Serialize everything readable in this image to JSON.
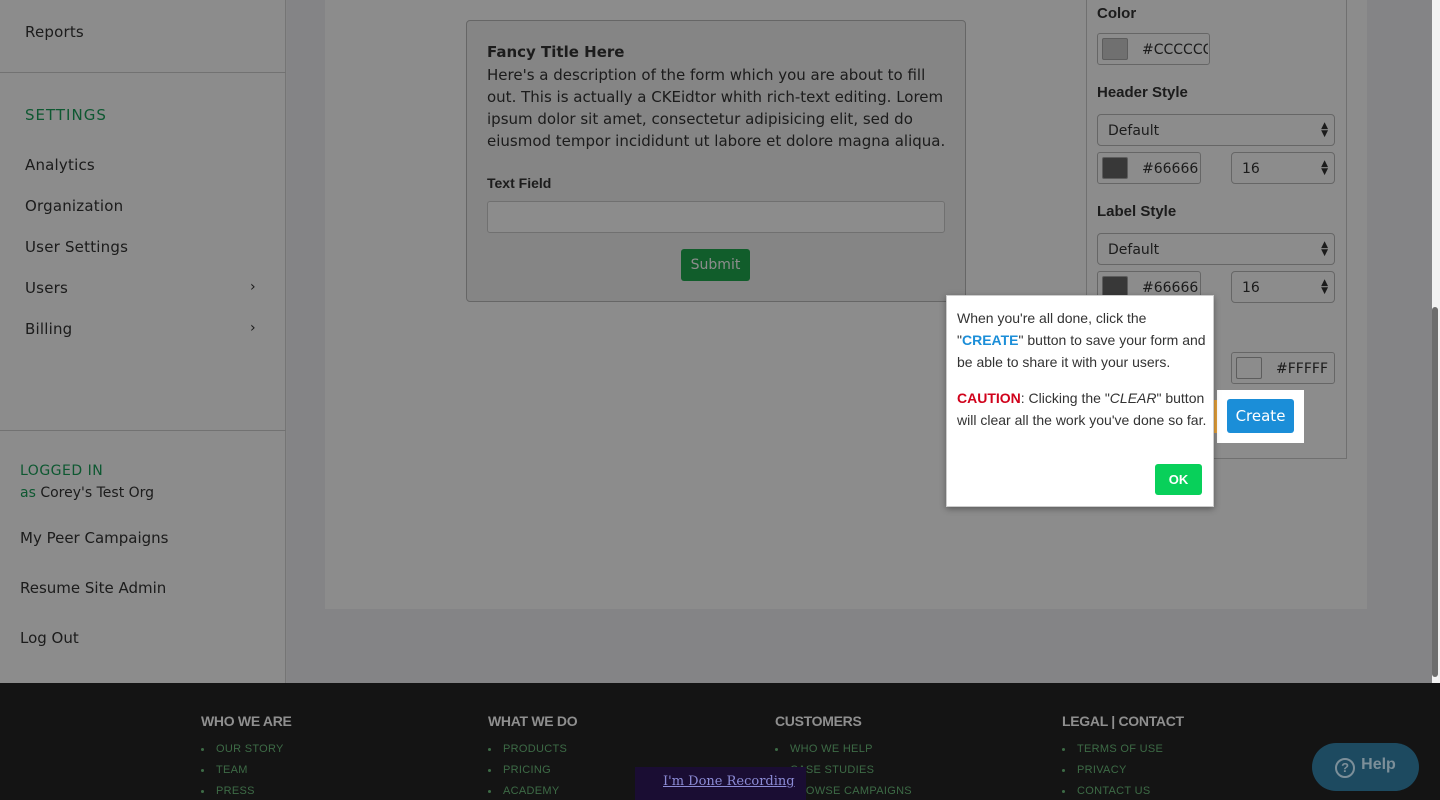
{
  "sidebar": {
    "reports": "Reports",
    "settings_heading": "SETTINGS",
    "items": [
      {
        "label": "Analytics"
      },
      {
        "label": "Organization"
      },
      {
        "label": "User Settings"
      },
      {
        "label": "Users",
        "chevron": "›"
      },
      {
        "label": "Billing",
        "chevron": "›"
      }
    ],
    "logged_in": "LOGGED IN",
    "as": "as",
    "org": "Corey's Test Org",
    "account_items": [
      "My Peer Campaigns",
      "Resume Site Admin",
      "Log Out"
    ]
  },
  "form_preview": {
    "title": "Fancy Title Here",
    "description": "Here's a description of the form which you are about to fill out. This is actually a CKEidtor whith rich-text editing. Lorem ipsum dolor sit amet, consectetur adipisicing elit, sed do eiusmod tempor incididunt ut labore et dolore magna aliqua.",
    "field_label": "Text Field",
    "submit_label": "Submit"
  },
  "style_panel": {
    "color_heading": "Color",
    "color_value": "#CCCCCC",
    "header_style_heading": "Header Style",
    "header_font": "Default",
    "header_color": "#66666",
    "header_size": "16",
    "label_style_heading": "Label Style",
    "label_font": "Default",
    "label_color": "#66666",
    "label_size": "16",
    "bg_color": "#FFFFF",
    "create_label": "Create"
  },
  "tooltip": {
    "p1_pre": "When you're all done, click the \"",
    "p1_kw": "CREATE",
    "p1_post": "\" button to save your form and be able to share it with your users.",
    "p2_kw": "CAUTION",
    "p2_mid": ": Clicking the \"",
    "p2_clear": "CLEAR",
    "p2_post": "\" button will clear all the work you've done so far.",
    "ok_label": "OK"
  },
  "footer": {
    "columns": [
      {
        "heading": "WHO WE ARE",
        "links": [
          "OUR STORY",
          "TEAM",
          "PRESS"
        ]
      },
      {
        "heading": "WHAT WE DO",
        "links": [
          "PRODUCTS",
          "PRICING",
          "ACADEMY"
        ]
      },
      {
        "heading": "CUSTOMERS",
        "links": [
          "WHO WE HELP",
          "CASE STUDIES",
          "BROWSE CAMPAIGNS"
        ]
      },
      {
        "heading": "LEGAL | CONTACT",
        "links": [
          "TERMS OF USE",
          "PRIVACY",
          "CONTACT US"
        ]
      }
    ],
    "recording_link": "I'm Done Recording",
    "help_label": "Help",
    "help_icon": "?"
  },
  "colors": {
    "accent_green": "#1aa05a",
    "create_blue": "#1b8ed8",
    "caution_red": "#d0021b",
    "ok_green": "#08d05a"
  }
}
